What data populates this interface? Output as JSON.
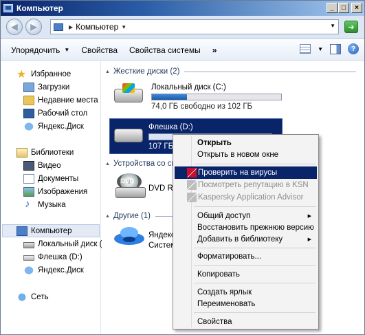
{
  "window": {
    "title": "Компьютер"
  },
  "address": {
    "path": "Компьютер"
  },
  "toolbar": {
    "organize": "Упорядочить",
    "properties": "Свойства",
    "system_properties": "Свойства системы",
    "more": "»"
  },
  "sidebar": {
    "favorites": {
      "label": "Избранное",
      "items": [
        "Загрузки",
        "Недавние места",
        "Рабочий стол",
        "Яндекс.Диск"
      ]
    },
    "libraries": {
      "label": "Библиотеки",
      "items": [
        "Видео",
        "Документы",
        "Изображения",
        "Музыка"
      ]
    },
    "computer": {
      "label": "Компьютер",
      "items": [
        "Локальный диск (",
        "Флешка (D:)",
        "Яндекс.Диск"
      ]
    },
    "network": {
      "label": "Сеть"
    }
  },
  "content": {
    "hard_disks_header": "Жесткие диски (2)",
    "local_disk": {
      "name": "Локальный диск (C:)",
      "free": "74,0 ГБ свободно из 102 ГБ",
      "used_fraction": 0.27
    },
    "usb": {
      "name": "Флешка (D:)",
      "free": "107 ГБ"
    },
    "removable_header": "Устройства со сь",
    "dvd": {
      "name": "DVD RW",
      "badge": "DVD"
    },
    "other_header": "Другие (1)",
    "yandex": {
      "line1": "Яндекс",
      "line2": "Систем"
    }
  },
  "context_menu": {
    "items": [
      "Открыть",
      "Открыть в новом окне",
      "Проверить на вирусы",
      "Посмотреть репутацию в KSN",
      "Kaspersky Application Advisor",
      "Общий доступ",
      "Восстановить прежнюю версию",
      "Добавить в библиотеку",
      "Форматировать...",
      "Копировать",
      "Создать ярлык",
      "Переименовать",
      "Свойства"
    ]
  }
}
